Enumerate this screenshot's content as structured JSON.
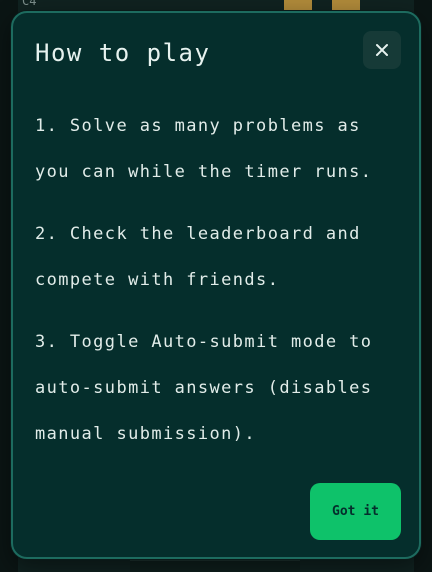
{
  "modal": {
    "title": "How to play",
    "close_icon": "close-icon",
    "steps": [
      "1. Solve as many problems as you can while the timer runs.",
      "2. Check the leaderboard and compete with friends.",
      "3. Toggle Auto-submit mode to auto-submit answers (disables manual submission)."
    ],
    "confirm_label": "Got it"
  },
  "background": {
    "corner_text": "C4"
  },
  "colors": {
    "modal_bg": "#052e2c",
    "modal_border": "#1d6b5f",
    "accent": "#0ec26a",
    "text": "#e1ece9"
  }
}
